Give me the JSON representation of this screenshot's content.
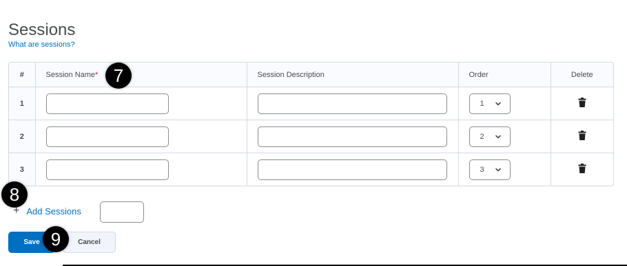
{
  "page": {
    "title": "Sessions",
    "help_link": "What are sessions?"
  },
  "table": {
    "headers": {
      "num": "#",
      "name": "Session Name",
      "name_required": "*",
      "description": "Session Description",
      "order": "Order",
      "delete": "Delete"
    },
    "rows": [
      {
        "num": "1",
        "name": "",
        "description": "",
        "order": "1"
      },
      {
        "num": "2",
        "name": "",
        "description": "",
        "order": "2"
      },
      {
        "num": "3",
        "name": "",
        "description": "",
        "order": "3"
      }
    ]
  },
  "add_sessions": {
    "icon": "plus-icon",
    "label": "Add Sessions",
    "count_value": ""
  },
  "actions": {
    "save_label": "Save",
    "cancel_label": "Cancel"
  },
  "callouts": [
    "7",
    "8",
    "9"
  ],
  "colors": {
    "link": "#006fbf",
    "primary_button": "#006fbf",
    "required": "#cd2026",
    "callout": "#000000"
  }
}
